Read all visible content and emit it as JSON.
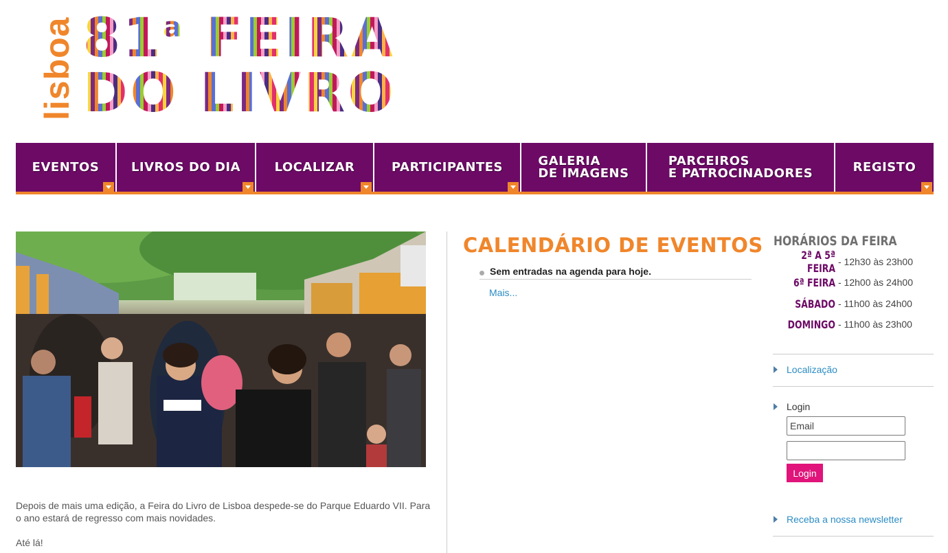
{
  "logo": {
    "side_text": "lisboa",
    "line1_main": "81",
    "line1_sup": "a",
    "line1_rest": "FEIRA",
    "line2": "DO LIVRO"
  },
  "nav": [
    {
      "label": "EVENTOS",
      "has_dropdown": true
    },
    {
      "label": "LIVROS DO DIA",
      "has_dropdown": true
    },
    {
      "label": "LOCALIZAR",
      "has_dropdown": true
    },
    {
      "label": "PARTICIPANTES",
      "has_dropdown": true
    },
    {
      "label": "GALERIA\nDE IMAGENS",
      "has_dropdown": false
    },
    {
      "label": "PARCEIROS\nE PATROCINADORES",
      "has_dropdown": false
    },
    {
      "label": "REGISTO",
      "has_dropdown": true
    }
  ],
  "intro": {
    "paragraph1": "Depois de mais uma edição, a Feira do Livro de Lisboa despede-se do Parque Eduardo VII. Para o ano estará de regresso com mais novidades.",
    "paragraph2": "Até lá!"
  },
  "calendar": {
    "title": "CALENDÁRIO DE EVENTOS",
    "items": [
      "Sem entradas na agenda para hoje."
    ],
    "more_link": "Mais..."
  },
  "hours": {
    "title": "HORÁRIOS DA FEIRA",
    "rows": [
      {
        "day": "2ª A 5ª FEIRA",
        "time": "- 12h30 às 23h00"
      },
      {
        "day": "6ª FEIRA",
        "time": "- 12h00 às 24h00"
      },
      {
        "day": "SÁBADO",
        "time": "- 11h00 às 24h00"
      },
      {
        "day": "DOMINGO",
        "time": "- 11h00 às 23h00"
      }
    ]
  },
  "sidebar": {
    "location_link": "Localização",
    "login_label": "Login",
    "email_placeholder": "Email",
    "password_placeholder": "",
    "login_button": "Login",
    "newsletter_link": "Receba a nossa newsletter"
  },
  "colors": {
    "nav_bg": "#6d0a66",
    "accent_orange": "#f0862b",
    "link_blue": "#2b8cc4",
    "login_pink": "#e0147a"
  }
}
